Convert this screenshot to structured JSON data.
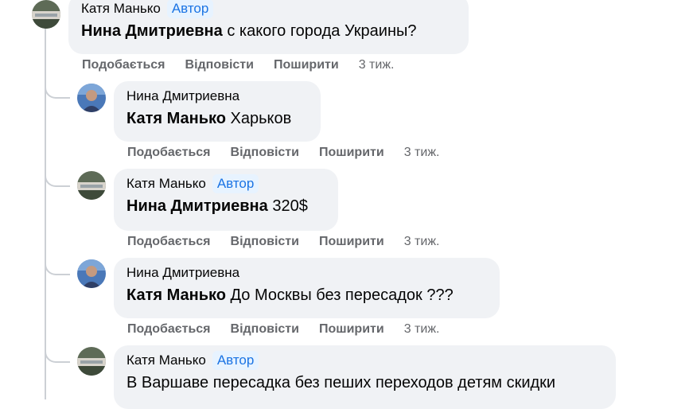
{
  "comments": [
    {
      "author": "Катя Манько",
      "badge": "Автор",
      "mention": "Нина Дмитриевна",
      "text": "с какого города Украины?",
      "actions": {
        "like": "Подобається",
        "reply": "Відповісти",
        "share": "Поширити",
        "time": "3 тиж."
      }
    },
    {
      "author": "Нина Дмитриевна",
      "badge": "",
      "mention": "Катя Манько",
      "text": "Харьков",
      "actions": {
        "like": "Подобається",
        "reply": "Відповісти",
        "share": "Поширити",
        "time": "3 тиж."
      }
    },
    {
      "author": "Катя Манько",
      "badge": "Автор",
      "mention": "Нина Дмитриевна",
      "text": "320$",
      "actions": {
        "like": "Подобається",
        "reply": "Відповісти",
        "share": "Поширити",
        "time": "3 тиж."
      }
    },
    {
      "author": "Нина Дмитриевна",
      "badge": "",
      "mention": "Катя Манько",
      "text": "До Москвы без пересадок ???",
      "actions": {
        "like": "Подобається",
        "reply": "Відповісти",
        "share": "Поширити",
        "time": "3 тиж."
      }
    },
    {
      "author": "Катя Манько",
      "badge": "Автор",
      "mention": "",
      "text": "В Варшаве пересадка без пеших переходов детям скидки",
      "actions": null
    }
  ]
}
